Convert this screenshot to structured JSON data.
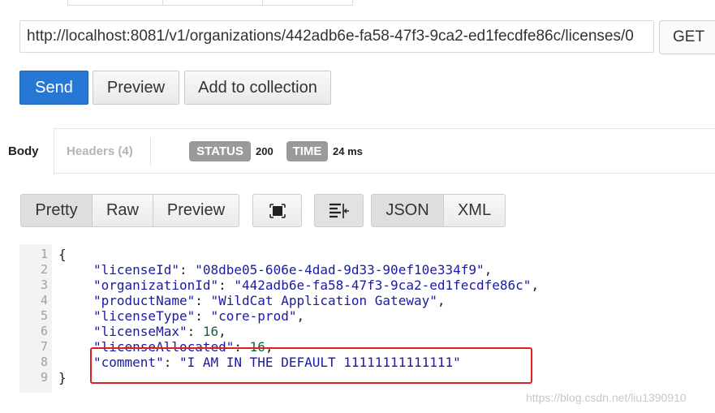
{
  "request": {
    "url": "http://localhost:8081/v1/organizations/442adb6e-fa58-47f3-9ca2-ed1fecdfe86c/licenses/0",
    "method": "GET"
  },
  "actions": {
    "send": "Send",
    "preview": "Preview",
    "add_to_collection": "Add to collection"
  },
  "response": {
    "tabs": {
      "body": "Body",
      "headers": "Headers (4)"
    },
    "status_label": "STATUS",
    "status_value": "200",
    "time_label": "TIME",
    "time_value": "24 ms"
  },
  "view_modes": {
    "pretty": "Pretty",
    "raw": "Raw",
    "preview": "Preview",
    "json": "JSON",
    "xml": "XML"
  },
  "code": {
    "line_numbers": [
      "1",
      "2",
      "3",
      "4",
      "5",
      "6",
      "7",
      "8",
      "9"
    ],
    "fields": [
      {
        "key": "\"licenseId\"",
        "value": "\"08dbe05-606e-4dad-9d33-90ef10e334f9\"",
        "type": "string",
        "trail": ","
      },
      {
        "key": "\"organizationId\"",
        "value": "\"442adb6e-fa58-47f3-9ca2-ed1fecdfe86c\"",
        "type": "string",
        "trail": ","
      },
      {
        "key": "\"productName\"",
        "value": "\"WildCat Application Gateway\"",
        "type": "string",
        "trail": ","
      },
      {
        "key": "\"licenseType\"",
        "value": "\"core-prod\"",
        "type": "string",
        "trail": ","
      },
      {
        "key": "\"licenseMax\"",
        "value": "16",
        "type": "number",
        "trail": ","
      },
      {
        "key": "\"licenseAllocated\"",
        "value": "16",
        "type": "number",
        "trail": ","
      },
      {
        "key": "\"comment\"",
        "value": "\"I AM IN THE DEFAULT 11111111111111\"",
        "type": "string",
        "trail": ""
      }
    ],
    "open_brace": "{",
    "close_brace": "}"
  },
  "watermark": "https://blog.csdn.net/liu1390910"
}
